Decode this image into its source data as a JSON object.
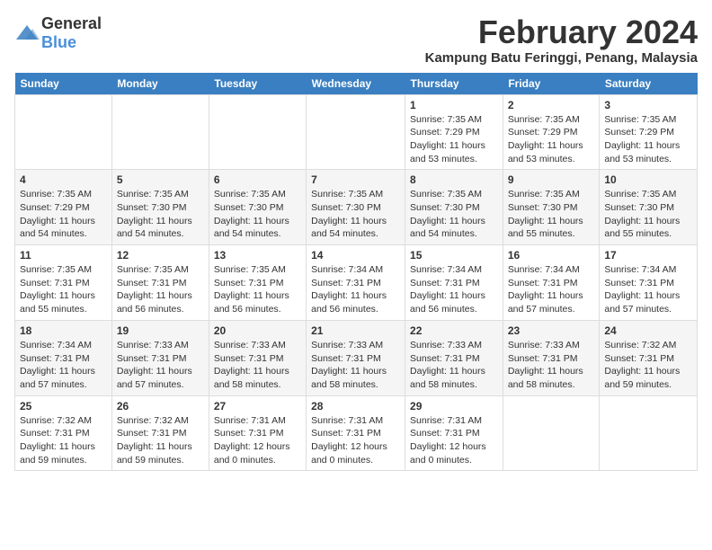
{
  "logo": {
    "general": "General",
    "blue": "Blue"
  },
  "title": {
    "month_year": "February 2024",
    "location": "Kampung Batu Feringgi, Penang, Malaysia"
  },
  "weekdays": [
    "Sunday",
    "Monday",
    "Tuesday",
    "Wednesday",
    "Thursday",
    "Friday",
    "Saturday"
  ],
  "weeks": [
    [
      {
        "day": "",
        "info": ""
      },
      {
        "day": "",
        "info": ""
      },
      {
        "day": "",
        "info": ""
      },
      {
        "day": "",
        "info": ""
      },
      {
        "day": "1",
        "info": "Sunrise: 7:35 AM\nSunset: 7:29 PM\nDaylight: 11 hours\nand 53 minutes."
      },
      {
        "day": "2",
        "info": "Sunrise: 7:35 AM\nSunset: 7:29 PM\nDaylight: 11 hours\nand 53 minutes."
      },
      {
        "day": "3",
        "info": "Sunrise: 7:35 AM\nSunset: 7:29 PM\nDaylight: 11 hours\nand 53 minutes."
      }
    ],
    [
      {
        "day": "4",
        "info": "Sunrise: 7:35 AM\nSunset: 7:29 PM\nDaylight: 11 hours\nand 54 minutes."
      },
      {
        "day": "5",
        "info": "Sunrise: 7:35 AM\nSunset: 7:30 PM\nDaylight: 11 hours\nand 54 minutes."
      },
      {
        "day": "6",
        "info": "Sunrise: 7:35 AM\nSunset: 7:30 PM\nDaylight: 11 hours\nand 54 minutes."
      },
      {
        "day": "7",
        "info": "Sunrise: 7:35 AM\nSunset: 7:30 PM\nDaylight: 11 hours\nand 54 minutes."
      },
      {
        "day": "8",
        "info": "Sunrise: 7:35 AM\nSunset: 7:30 PM\nDaylight: 11 hours\nand 54 minutes."
      },
      {
        "day": "9",
        "info": "Sunrise: 7:35 AM\nSunset: 7:30 PM\nDaylight: 11 hours\nand 55 minutes."
      },
      {
        "day": "10",
        "info": "Sunrise: 7:35 AM\nSunset: 7:30 PM\nDaylight: 11 hours\nand 55 minutes."
      }
    ],
    [
      {
        "day": "11",
        "info": "Sunrise: 7:35 AM\nSunset: 7:31 PM\nDaylight: 11 hours\nand 55 minutes."
      },
      {
        "day": "12",
        "info": "Sunrise: 7:35 AM\nSunset: 7:31 PM\nDaylight: 11 hours\nand 56 minutes."
      },
      {
        "day": "13",
        "info": "Sunrise: 7:35 AM\nSunset: 7:31 PM\nDaylight: 11 hours\nand 56 minutes."
      },
      {
        "day": "14",
        "info": "Sunrise: 7:34 AM\nSunset: 7:31 PM\nDaylight: 11 hours\nand 56 minutes."
      },
      {
        "day": "15",
        "info": "Sunrise: 7:34 AM\nSunset: 7:31 PM\nDaylight: 11 hours\nand 56 minutes."
      },
      {
        "day": "16",
        "info": "Sunrise: 7:34 AM\nSunset: 7:31 PM\nDaylight: 11 hours\nand 57 minutes."
      },
      {
        "day": "17",
        "info": "Sunrise: 7:34 AM\nSunset: 7:31 PM\nDaylight: 11 hours\nand 57 minutes."
      }
    ],
    [
      {
        "day": "18",
        "info": "Sunrise: 7:34 AM\nSunset: 7:31 PM\nDaylight: 11 hours\nand 57 minutes."
      },
      {
        "day": "19",
        "info": "Sunrise: 7:33 AM\nSunset: 7:31 PM\nDaylight: 11 hours\nand 57 minutes."
      },
      {
        "day": "20",
        "info": "Sunrise: 7:33 AM\nSunset: 7:31 PM\nDaylight: 11 hours\nand 58 minutes."
      },
      {
        "day": "21",
        "info": "Sunrise: 7:33 AM\nSunset: 7:31 PM\nDaylight: 11 hours\nand 58 minutes."
      },
      {
        "day": "22",
        "info": "Sunrise: 7:33 AM\nSunset: 7:31 PM\nDaylight: 11 hours\nand 58 minutes."
      },
      {
        "day": "23",
        "info": "Sunrise: 7:33 AM\nSunset: 7:31 PM\nDaylight: 11 hours\nand 58 minutes."
      },
      {
        "day": "24",
        "info": "Sunrise: 7:32 AM\nSunset: 7:31 PM\nDaylight: 11 hours\nand 59 minutes."
      }
    ],
    [
      {
        "day": "25",
        "info": "Sunrise: 7:32 AM\nSunset: 7:31 PM\nDaylight: 11 hours\nand 59 minutes."
      },
      {
        "day": "26",
        "info": "Sunrise: 7:32 AM\nSunset: 7:31 PM\nDaylight: 11 hours\nand 59 minutes."
      },
      {
        "day": "27",
        "info": "Sunrise: 7:31 AM\nSunset: 7:31 PM\nDaylight: 12 hours\nand 0 minutes."
      },
      {
        "day": "28",
        "info": "Sunrise: 7:31 AM\nSunset: 7:31 PM\nDaylight: 12 hours\nand 0 minutes."
      },
      {
        "day": "29",
        "info": "Sunrise: 7:31 AM\nSunset: 7:31 PM\nDaylight: 12 hours\nand 0 minutes."
      },
      {
        "day": "",
        "info": ""
      },
      {
        "day": "",
        "info": ""
      }
    ]
  ]
}
